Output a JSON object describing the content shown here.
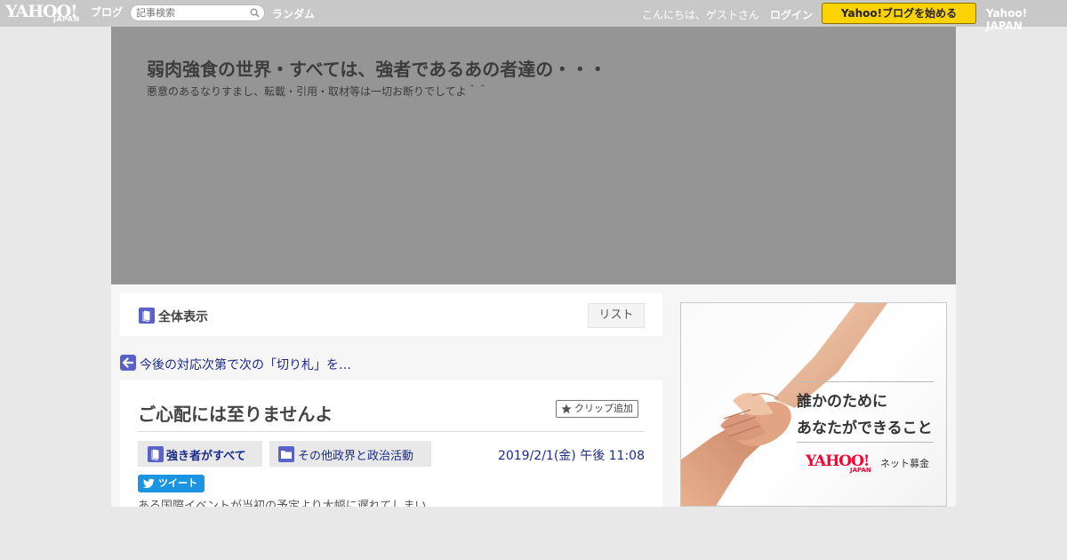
{
  "topbar": {
    "logo_main": "YAHOO!",
    "logo_sub": "JAPAN",
    "logo_blog": "ブログ",
    "search_placeholder": "記事検索",
    "random_label": "ランダム",
    "greeting": "こんにちは、ゲストさん",
    "login_label": "ログイン",
    "start_blog_label": "Yahoo!ブログを始める",
    "yahoo_japan_label": "Yahoo! JAPAN"
  },
  "header": {
    "blog_title": "弱肉強食の世界・すべては、強者であるあの者達の・・・",
    "blog_description": "悪意のあるなりすまし、転載・引用・取材等は一切お断りでしてよ＾＾"
  },
  "listbar": {
    "view_all_label": "全体表示",
    "list_button_label": "リスト"
  },
  "navigation": {
    "prev_article_label": "今後の対応次第で次の「切り札」を…"
  },
  "article": {
    "title": "ご心配には至りませんよ",
    "clip_label": "クリップ追加",
    "category_label": "強き者がすべて",
    "genre_label": "その他政界と政治活動",
    "date": "2019/2/1(金) 午後 11:08",
    "tweet_label": "ツイート",
    "body_preview": "ある国際イベントが当初の予定より大幅に遅れてしまい……"
  },
  "ad": {
    "line1": "誰かのために",
    "line2": "あなたができること",
    "logo_main": "YAHOO!",
    "logo_sub": "JAPAN",
    "service_label": "ネット募金"
  },
  "colors": {
    "topbar_bg": "#c8c8c8",
    "header_bg": "#959595",
    "link_blue": "#1a2b8c",
    "start_button_yellow": "#fcd200",
    "tweet_blue": "#1b95e0",
    "icon_purple": "#5a62c8"
  }
}
